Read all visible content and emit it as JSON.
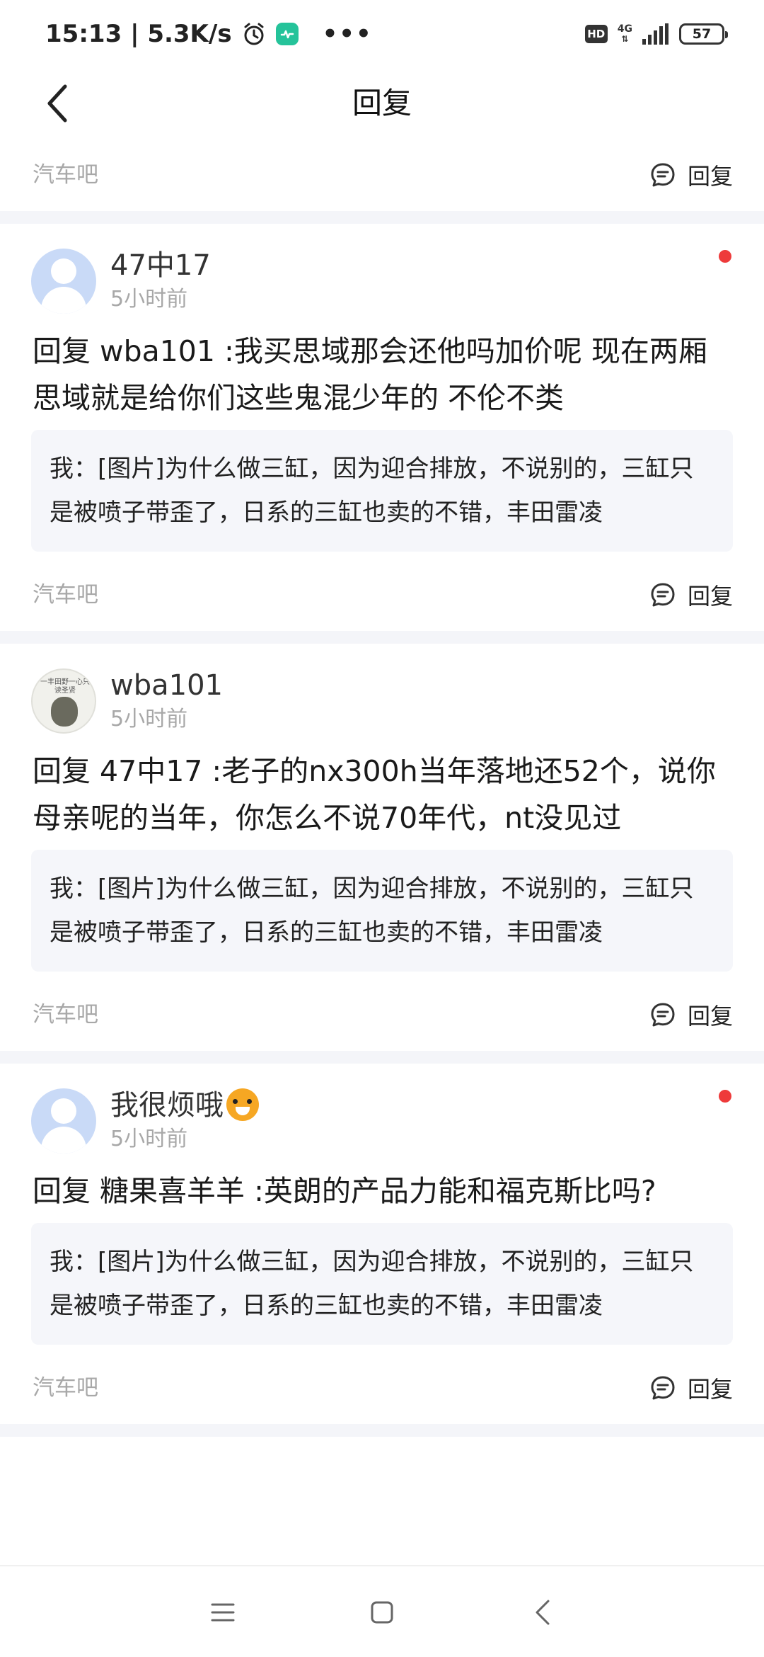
{
  "status_bar": {
    "time_speed": "15:13 | 5.3K/s",
    "hd": "HD",
    "network": "4G",
    "battery": "57"
  },
  "header": {
    "title": "回复"
  },
  "top_partial": {
    "forum": "汽车吧",
    "reply_label": "回复"
  },
  "items": [
    {
      "username": "47中17",
      "time": "5小时前",
      "unread": true,
      "reply_text": "回复 wba101 :我买思域那会还他吗加价呢 现在两厢思域就是给你们这些鬼混少年的 不伦不类",
      "quote": "我：[图片]为什么做三缸，因为迎合排放，不说别的，三缸只是被喷子带歪了，日系的三缸也卖的不错，丰田雷凌",
      "forum": "汽车吧",
      "reply_label": "回复"
    },
    {
      "username": "wba101",
      "time": "5小时前",
      "unread": false,
      "reply_text": "回复 47中17 :老子的nx300h当年落地还52个，说你母亲呢的当年，你怎么不说70年代，nt没见过",
      "quote": "我：[图片]为什么做三缸，因为迎合排放，不说别的，三缸只是被喷子带歪了，日系的三缸也卖的不错，丰田雷凌",
      "forum": "汽车吧",
      "reply_label": "回复"
    },
    {
      "username": "我很烦哦",
      "time": "5小时前",
      "unread": true,
      "reply_text": "回复 糖果喜羊羊 :英朗的产品力能和福克斯比吗?",
      "quote": "我：[图片]为什么做三缸，因为迎合排放，不说别的，三缸只是被喷子带歪了，日系的三缸也卖的不错，丰田雷凌",
      "forum": "汽车吧",
      "reply_label": "回复"
    }
  ],
  "avatar_text": "一丰田野一心只读圣贤"
}
